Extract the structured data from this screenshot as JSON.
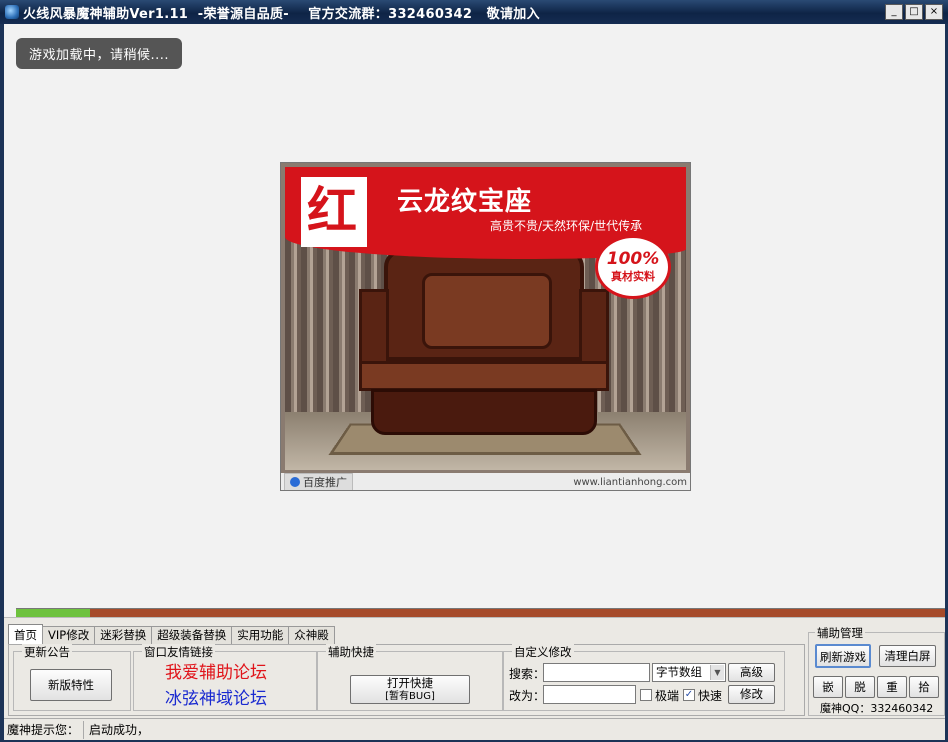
{
  "window": {
    "title": "火线风暴魔神辅助Ver1.11  -荣誉源自品质-    官方交流群：332460342   敬请加入",
    "controls": {
      "minimize": "_",
      "maximize": "□",
      "close": "×"
    }
  },
  "game_area": {
    "loading_text": "游戏加载中，请稍候....",
    "ad": {
      "logo_text": "红",
      "headline": "云龙纹宝座",
      "subheadline": "高贵不贵/天然环保/世代传承",
      "badge_top": "100%",
      "badge_bottom": "真材实料",
      "footer_tag": "百度推广",
      "footer_url": "www.liantianhong.com"
    }
  },
  "progress": {
    "value_fraction": 0.08
  },
  "tabs": [
    {
      "label": "首页",
      "active": true
    },
    {
      "label": "VIP修改",
      "active": false
    },
    {
      "label": "迷彩替换",
      "active": false
    },
    {
      "label": "超级装备替换",
      "active": false
    },
    {
      "label": "实用功能",
      "active": false
    },
    {
      "label": "众神殿",
      "active": false
    }
  ],
  "home": {
    "announce": {
      "title": "更新公告",
      "button": "新版特性"
    },
    "links": {
      "title": "窗口友情链接",
      "link1": "我爱辅助论坛",
      "link2": "冰弦神域论坛"
    },
    "hotkey": {
      "title": "辅助快捷",
      "button_line1": "打开快捷",
      "button_line2": "[暂有BUG]"
    },
    "custom": {
      "title": "自定义修改",
      "search_label": "搜索：",
      "search_value": "",
      "mode_select": "字节数组",
      "advanced_button": "高级",
      "change_label": "改为：",
      "change_value": "",
      "extreme_label": "极端",
      "extreme_checked": false,
      "fast_label": "快速",
      "fast_checked": true,
      "modify_button": "修改"
    }
  },
  "management": {
    "title": "辅助管理",
    "refresh_button": "刷新游戏",
    "clear_button": "清理白屏",
    "small_buttons": [
      "嵌",
      "脱",
      "重",
      "拾"
    ],
    "qq_text": "魔神QQ：332460342"
  },
  "status": {
    "label": "魔神提示您：",
    "message": "启动成功，"
  },
  "colors": {
    "titlebar": "#0e2446",
    "progress_fill": "#6ec23e",
    "progress_track": "#a64b2a",
    "ad_red": "#d5141b"
  }
}
